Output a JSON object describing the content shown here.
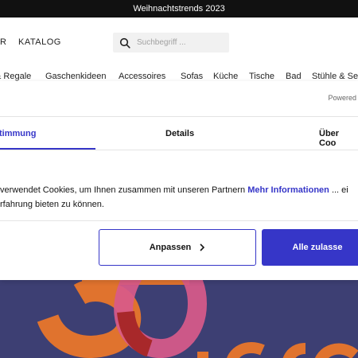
{
  "promo_bar": {
    "text": "Weihnachtstrends 2023"
  },
  "header": {
    "nav_partial": "R",
    "nav_katalog": "KATALOG",
    "search": {
      "placeholder": "Suchbegriff ...",
      "icon": "search-icon"
    }
  },
  "categories": [
    "& Regale",
    "Gaschenkideen",
    "Accessoires",
    "Sofas",
    "Küche",
    "Tische",
    "Bad",
    "Stühle & Se"
  ],
  "consent": {
    "powered_label": "Powered",
    "tabs": [
      "timmung",
      "Details",
      "Über Coo"
    ],
    "active_tab": 0,
    "text_line1_a": "verwendet Cookies, um Ihnen zusammen mit unseren Partnern ",
    "text_link": "Mehr Informationen",
    "text_line1_b": " ... ei",
    "text_line2": "rfahrung bieten zu können.",
    "btn_customize": "Anpassen",
    "btn_allow_all": "Alle zulasse"
  },
  "colors": {
    "accent": "#3636c8",
    "hero_bg": "#3d3f73",
    "hero_orange": "#e0732e",
    "hero_pink": "#d85a8a",
    "hero_red": "#a8282a"
  }
}
